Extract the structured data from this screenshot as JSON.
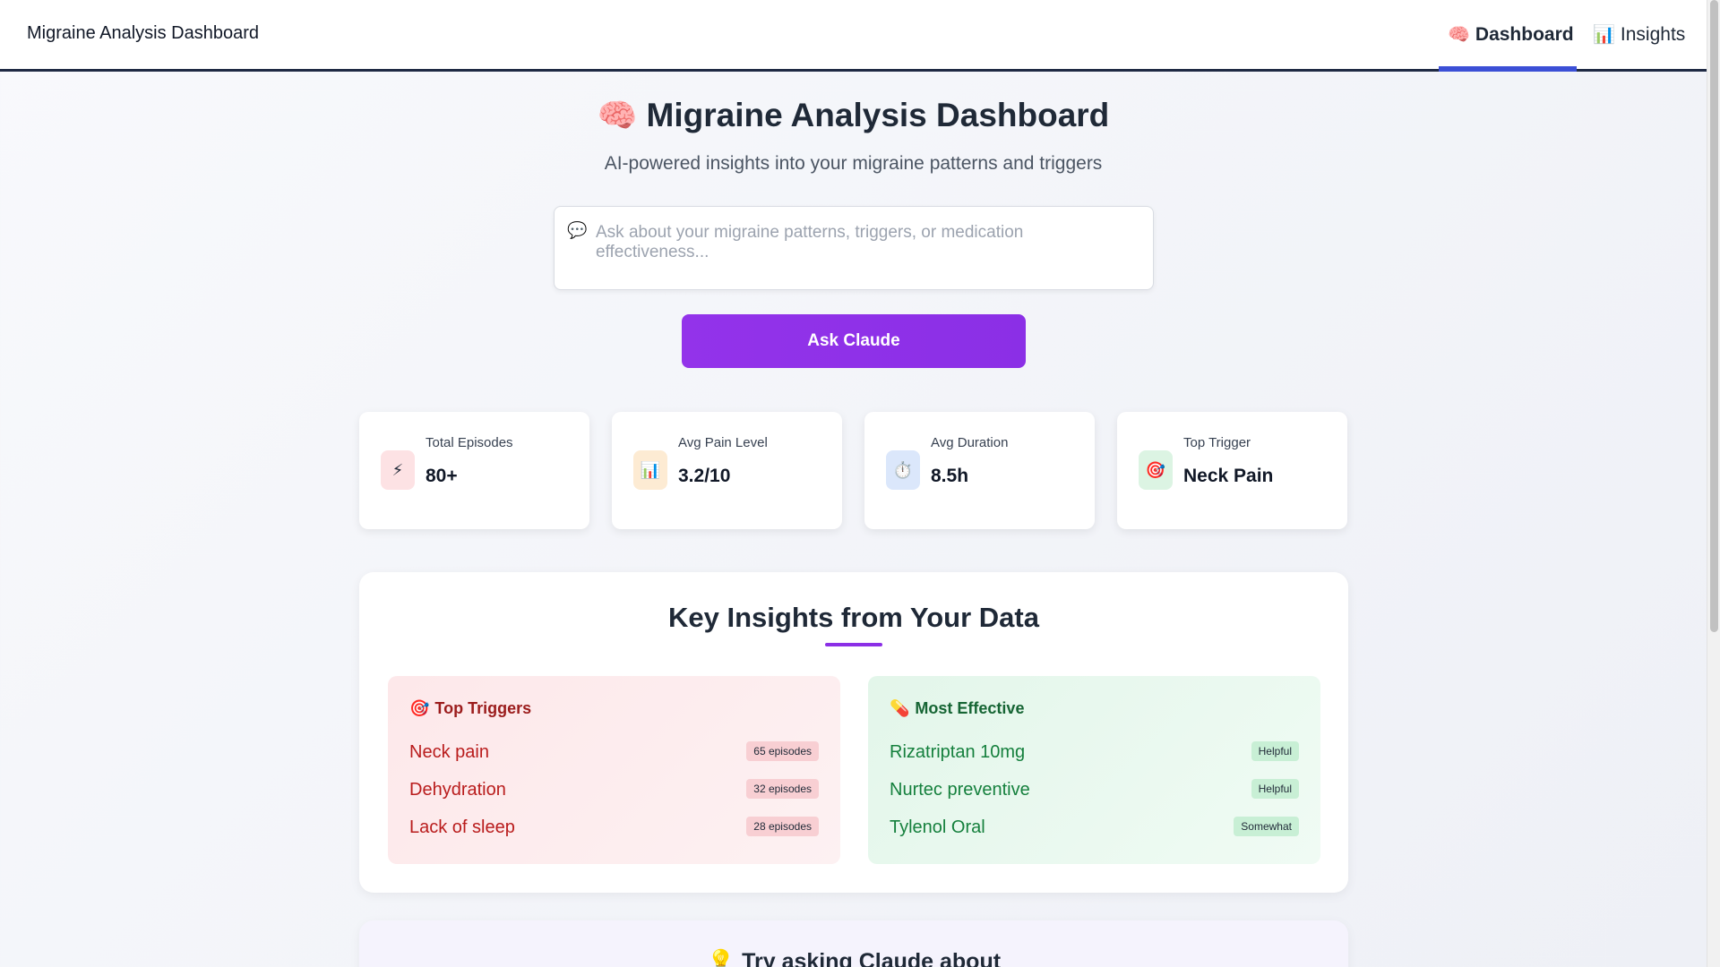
{
  "nav": {
    "brand": "Migraine Analysis Dashboard",
    "tabs": [
      {
        "icon": "🧠",
        "icon_name": "brain-icon",
        "label": "Dashboard",
        "active": true
      },
      {
        "icon": "📊",
        "icon_name": "chart-icon",
        "label": "Insights",
        "active": false
      }
    ],
    "accent": "#3b4fd6"
  },
  "hero": {
    "icon": "🧠",
    "icon_name": "brain-icon",
    "title": "Migraine Analysis Dashboard",
    "subtitle": "AI-powered insights into your migraine patterns and triggers"
  },
  "ask": {
    "icon": "💬",
    "icon_name": "speech-bubble-icon",
    "placeholder": "Ask about your migraine patterns, triggers, or medication effectiveness...",
    "value": "",
    "button_label": "Ask Claude",
    "button_color": "#9333ea"
  },
  "stats": [
    {
      "icon": "⚡",
      "icon_name": "lightning-icon",
      "icon_bg": "#fde2e4",
      "label": "Total Episodes",
      "value": "80+"
    },
    {
      "icon": "📊",
      "icon_name": "bar-chart-icon",
      "icon_bg": "#fdebd3",
      "label": "Avg Pain Level",
      "value": "3.2/10"
    },
    {
      "icon": "⏱️",
      "icon_name": "stopwatch-icon",
      "icon_bg": "#dbe7fb",
      "label": "Avg Duration",
      "value": "8.5h"
    },
    {
      "icon": "🎯",
      "icon_name": "target-icon",
      "icon_bg": "#dcf4e3",
      "label": "Top Trigger",
      "value": "Neck Pain"
    }
  ],
  "insights": {
    "title": "Key Insights from Your Data",
    "triggers": {
      "icon": "🎯",
      "icon_name": "target-icon",
      "heading": "Top Triggers",
      "items": [
        {
          "name": "Neck pain",
          "badge": "65 episodes"
        },
        {
          "name": "Dehydration",
          "badge": "32 episodes"
        },
        {
          "name": "Lack of sleep",
          "badge": "28 episodes"
        }
      ]
    },
    "effective": {
      "icon": "💊",
      "icon_name": "pill-icon",
      "heading": "Most Effective",
      "items": [
        {
          "name": "Rizatriptan 10mg",
          "badge": "Helpful"
        },
        {
          "name": "Nurtec preventive",
          "badge": "Helpful"
        },
        {
          "name": "Tylenol Oral",
          "badge": "Somewhat"
        }
      ]
    }
  },
  "suggestions": {
    "icon": "💡",
    "icon_name": "lightbulb-icon",
    "title": "Try asking Claude about"
  }
}
